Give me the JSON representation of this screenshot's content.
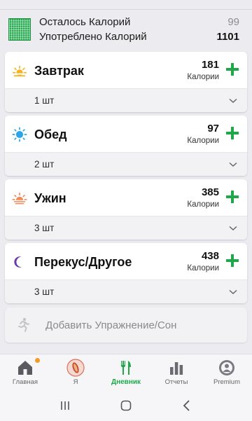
{
  "summary": {
    "remaining_label": "Осталось Калорий",
    "consumed_label": "Употреблено Калорий",
    "remaining_value": "99",
    "consumed_value": "1101",
    "icon": "calorie-grid-icon"
  },
  "meals": [
    {
      "title": "Завтрак",
      "calories": "181",
      "unit": "Калории",
      "qty": "1 шт",
      "icon": "sunrise-icon"
    },
    {
      "title": "Обед",
      "calories": "97",
      "unit": "Калории",
      "qty": "2 шт",
      "icon": "sun-icon"
    },
    {
      "title": "Ужин",
      "calories": "385",
      "unit": "Калории",
      "qty": "3 шт",
      "icon": "sunset-icon"
    },
    {
      "title": "Перекус/Другое",
      "calories": "438",
      "unit": "Калории",
      "qty": "3 шт",
      "icon": "moon-icon"
    }
  ],
  "exercise": {
    "label": "Добавить Упражнение/Сон",
    "icon": "running-icon"
  },
  "nav": [
    {
      "label": "Главная",
      "icon": "home-icon",
      "badge": true
    },
    {
      "label": "Я",
      "icon": "profile-icon"
    },
    {
      "label": "Дневник",
      "icon": "fork-knife-icon",
      "active": true
    },
    {
      "label": "Отчеты",
      "icon": "bar-chart-icon"
    },
    {
      "label": "Premium",
      "icon": "premium-icon"
    }
  ],
  "colors": {
    "accent": "#1ea84a",
    "badge": "#f59a23",
    "sun": "#f6b21f",
    "sun_blue": "#2aa5e8",
    "sunset": "#f28a5a",
    "moon": "#6a3aa8"
  }
}
